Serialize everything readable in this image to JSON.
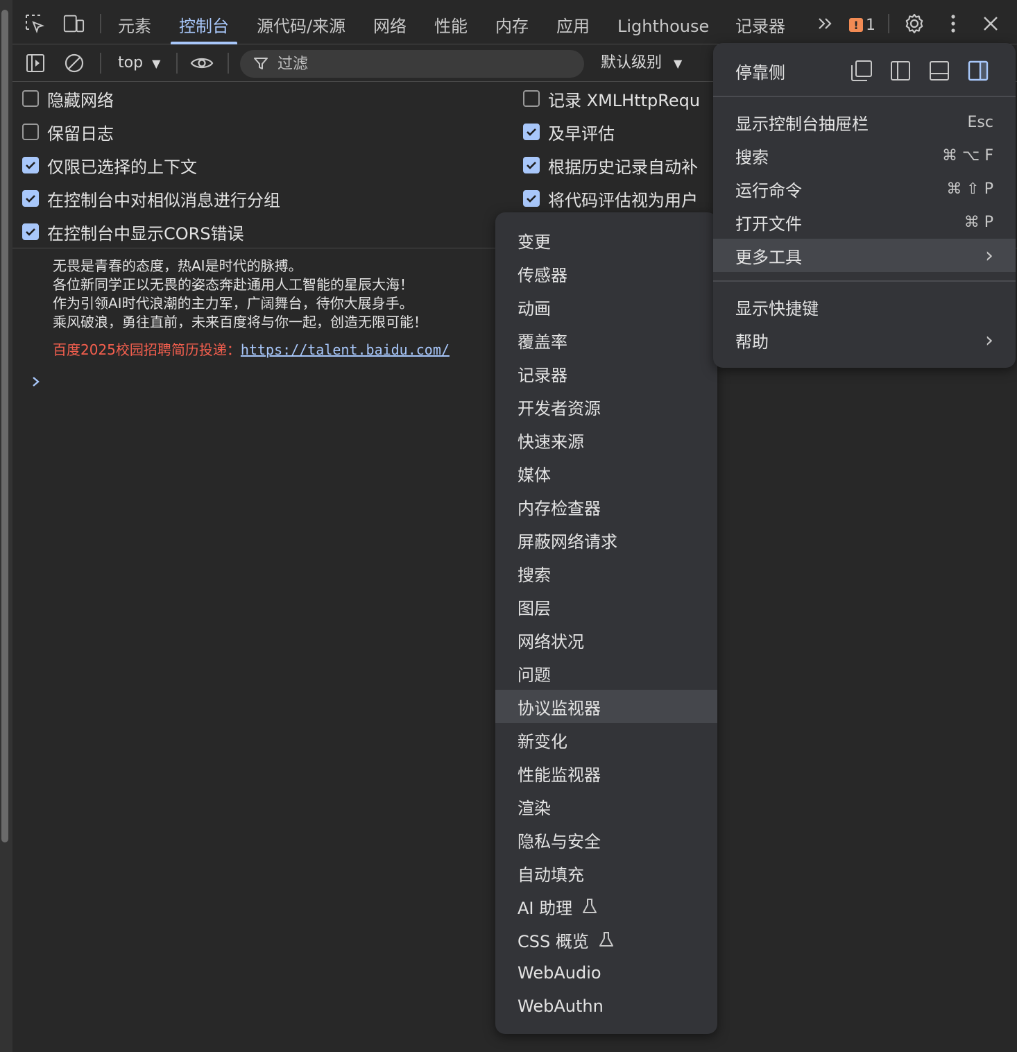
{
  "tabs": [
    {
      "label": "元素"
    },
    {
      "label": "控制台"
    },
    {
      "label": "源代码/来源"
    },
    {
      "label": "网络"
    },
    {
      "label": "性能"
    },
    {
      "label": "内存"
    },
    {
      "label": "应用"
    },
    {
      "label": "Lighthouse"
    },
    {
      "label": "记录器"
    }
  ],
  "active_tab": "控制台",
  "issues_count": "1",
  "toolbar": {
    "context": "top",
    "filter_placeholder": "过滤",
    "levels": "默认级别"
  },
  "settings": {
    "left": [
      {
        "label": "隐藏网络",
        "checked": false
      },
      {
        "label": "保留日志",
        "checked": false
      },
      {
        "label": "仅限已选择的上下文",
        "checked": true
      },
      {
        "label": "在控制台中对相似消息进行分组",
        "checked": true
      },
      {
        "label": "在控制台中显示CORS错误",
        "checked": true
      }
    ],
    "right": [
      {
        "label": "记录 XMLHttpReque",
        "checked": false
      },
      {
        "label": "及早评估",
        "checked": true
      },
      {
        "label": "根据历史记录自动补",
        "checked": true
      },
      {
        "label": "将代码评估视为用户",
        "checked": true
      }
    ]
  },
  "console": {
    "lines": [
      "无畏是青春的态度，热AI是时代的脉搏。",
      "各位新同学正以无畏的姿态奔赴通用人工智能的星辰大海！",
      "作为引领AI时代浪潮的主力军，广阔舞台，待你大展身手。",
      "乘风破浪，勇往直前，未来百度将与你一起，创造无限可能！"
    ],
    "recruit_prefix": "百度2025校园招聘简历投递：",
    "recruit_link": "https://talent.baidu.com/"
  },
  "main_menu": {
    "dock_label": "停靠侧",
    "items": [
      {
        "label": "显示控制台抽屉栏",
        "shortcut": "Esc"
      },
      {
        "label": "搜索",
        "shortcut": "⌘ ⌥ F"
      },
      {
        "label": "运行命令",
        "shortcut": "⌘ ⇧ P"
      },
      {
        "label": "打开文件",
        "shortcut": "⌘ P"
      },
      {
        "label": "更多工具",
        "shortcut": "›"
      }
    ],
    "items2": [
      {
        "label": "显示快捷键",
        "shortcut": ""
      },
      {
        "label": "帮助",
        "shortcut": "›"
      }
    ]
  },
  "more_tools": [
    {
      "label": "变更"
    },
    {
      "label": "传感器"
    },
    {
      "label": "动画"
    },
    {
      "label": "覆盖率"
    },
    {
      "label": "记录器"
    },
    {
      "label": "开发者资源"
    },
    {
      "label": "快速来源"
    },
    {
      "label": "媒体"
    },
    {
      "label": "内存检查器"
    },
    {
      "label": "屏蔽网络请求"
    },
    {
      "label": "搜索"
    },
    {
      "label": "图层"
    },
    {
      "label": "网络状况"
    },
    {
      "label": "问题"
    },
    {
      "label": "协议监视器"
    },
    {
      "label": "新变化"
    },
    {
      "label": "性能监视器"
    },
    {
      "label": "渲染"
    },
    {
      "label": "隐私与安全"
    },
    {
      "label": "自动填充"
    },
    {
      "label": "AI 助理",
      "experimental": true
    },
    {
      "label": "CSS 概览",
      "experimental": true
    },
    {
      "label": "WebAudio"
    },
    {
      "label": "WebAuthn"
    }
  ],
  "highlighted_tool": "协议监视器",
  "colors": {
    "accent": "#a8c7fa",
    "error": "#f55f4e",
    "issue": "#f28b54"
  }
}
